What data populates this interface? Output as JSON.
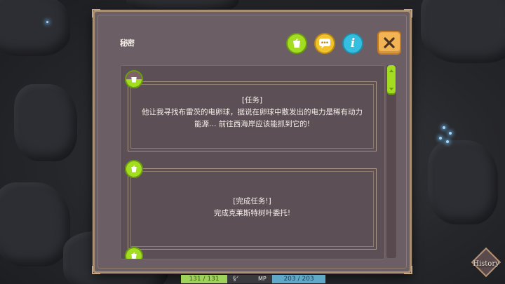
{
  "dialog": {
    "portrait_label": "秘密",
    "buttons": {
      "task_icon": "bucket-icon",
      "chat_icon": "speech-bubble-icon",
      "info_label": "i",
      "close_icon": "close-icon"
    }
  },
  "entries": [
    {
      "status": "pending",
      "title": "[任务]",
      "body": "他让我寻找布雷茨的电卵球，据说在卵球中散发出的电力是稀有动力能源… 前往西海岸应该能抓到它的!"
    },
    {
      "status": "done",
      "title": "[完成任务!]",
      "body": "完成克莱斯特树叶委托!"
    }
  ],
  "hud": {
    "hp": "131 / 131",
    "sep": "§ᐟ",
    "mp_label": "MP",
    "mp": "203 / 203"
  },
  "history": {
    "label": "History"
  },
  "colors": {
    "accent_green": "#a4dd1f",
    "accent_yellow": "#f2c12b",
    "accent_blue": "#34bfe0",
    "close_orange": "#f2b354",
    "dialog_bg": "#6b5e64"
  }
}
